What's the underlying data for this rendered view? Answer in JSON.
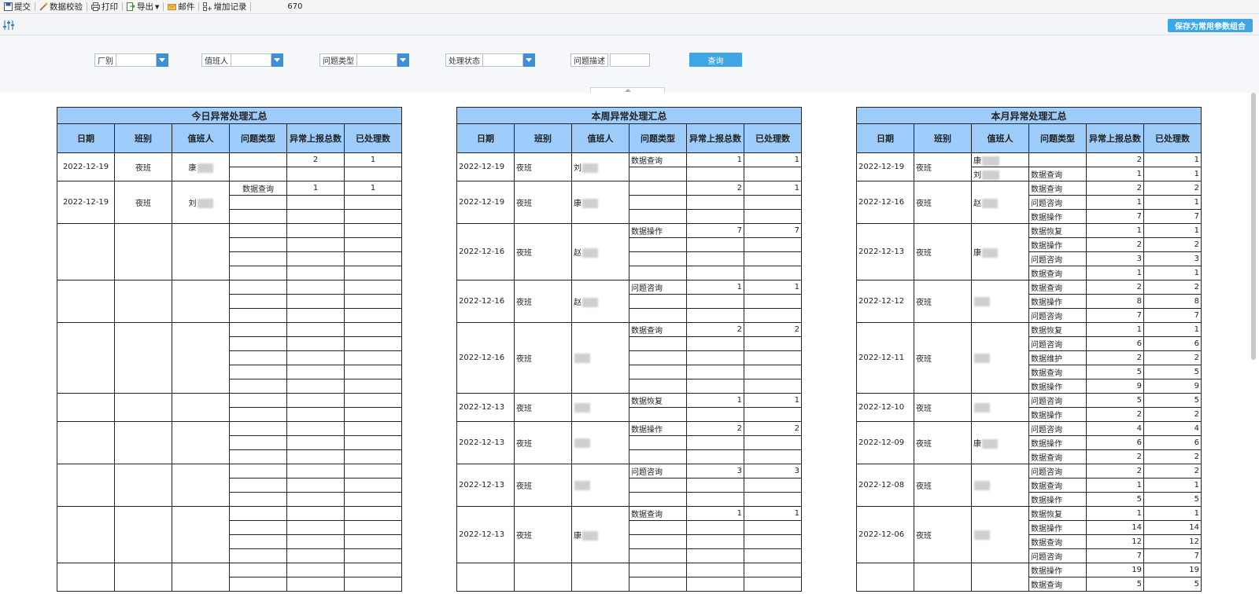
{
  "toolbar": {
    "submit_label": "提交",
    "validate_label": "数据校验",
    "print_label": "打印",
    "export_label": "导出",
    "mail_label": "邮件",
    "add_record_label": "增加记录",
    "record_count": "670"
  },
  "params": {
    "save_combo_label": "保存为常用参数组合",
    "factory_label": "厂别",
    "duty_person_label": "值班人",
    "issue_type_label": "问题类型",
    "status_label": "处理状态",
    "issue_desc_label": "问题描述",
    "query_label": "查询"
  },
  "colors": {
    "header_blue": "#9fcdfb",
    "accent": "#3ea6e5",
    "dropdown_blue": "#3d8fd6"
  },
  "headers": [
    "日期",
    "班别",
    "值班人",
    "问题类型",
    "异常上报总数",
    "已处理数"
  ],
  "today": {
    "title": "今日异常处理汇总",
    "groups": [
      {
        "date": "2022-12-19",
        "shift": "夜班",
        "person": "康",
        "rows": [
          [
            "",
            "2",
            "1"
          ],
          [
            "",
            "",
            ""
          ]
        ]
      },
      {
        "date": "2022-12-19",
        "shift": "夜班",
        "person": "刘",
        "rows": [
          [
            "数据查询",
            "1",
            "1"
          ],
          [
            "",
            "",
            ""
          ],
          [
            "",
            "",
            ""
          ]
        ]
      },
      {
        "date": "",
        "shift": "",
        "person": "",
        "rows": [
          [
            "",
            "",
            ""
          ],
          [
            "",
            "",
            ""
          ],
          [
            "",
            "",
            ""
          ],
          [
            "",
            "",
            ""
          ]
        ]
      },
      {
        "date": "",
        "shift": "",
        "person": "",
        "rows": [
          [
            "",
            "",
            ""
          ],
          [
            "",
            "",
            ""
          ],
          [
            "",
            "",
            ""
          ]
        ]
      },
      {
        "date": "",
        "shift": "",
        "person": "",
        "rows": [
          [
            "",
            "",
            ""
          ],
          [
            "",
            "",
            ""
          ],
          [
            "",
            "",
            ""
          ],
          [
            "",
            "",
            ""
          ],
          [
            "",
            "",
            ""
          ]
        ]
      },
      {
        "date": "",
        "shift": "",
        "person": "",
        "rows": [
          [
            "",
            "",
            ""
          ],
          [
            "",
            "",
            ""
          ]
        ]
      },
      {
        "date": "",
        "shift": "",
        "person": "",
        "rows": [
          [
            "",
            "",
            ""
          ],
          [
            "",
            "",
            ""
          ],
          [
            "",
            "",
            ""
          ]
        ]
      },
      {
        "date": "",
        "shift": "",
        "person": "",
        "rows": [
          [
            "",
            "",
            ""
          ],
          [
            "",
            "",
            ""
          ],
          [
            "",
            "",
            ""
          ]
        ]
      },
      {
        "date": "",
        "shift": "",
        "person": "",
        "rows": [
          [
            "",
            "",
            ""
          ],
          [
            "",
            "",
            ""
          ],
          [
            "",
            "",
            ""
          ],
          [
            "",
            "",
            ""
          ]
        ]
      },
      {
        "date": "",
        "shift": "",
        "person": "",
        "rows": [
          [
            "",
            "",
            ""
          ],
          [
            "",
            "",
            ""
          ]
        ]
      }
    ]
  },
  "week": {
    "title": "本周异常处理汇总",
    "groups": [
      {
        "date": "2022-12-19",
        "shift": "夜班",
        "person": "刘",
        "rows": [
          [
            "数据查询",
            "1",
            "1"
          ],
          [
            "",
            "",
            ""
          ]
        ]
      },
      {
        "date": "2022-12-19",
        "shift": "夜班",
        "person": "康",
        "rows": [
          [
            "",
            "2",
            "1"
          ],
          [
            "",
            "",
            ""
          ],
          [
            "",
            "",
            ""
          ]
        ]
      },
      {
        "date": "2022-12-16",
        "shift": "夜班",
        "person": "赵",
        "rows": [
          [
            "数据操作",
            "7",
            "7"
          ],
          [
            "",
            "",
            ""
          ],
          [
            "",
            "",
            ""
          ],
          [
            "",
            "",
            ""
          ]
        ]
      },
      {
        "date": "2022-12-16",
        "shift": "夜班",
        "person": "赵",
        "rows": [
          [
            "问题咨询",
            "1",
            "1"
          ],
          [
            "",
            "",
            ""
          ],
          [
            "",
            "",
            ""
          ]
        ]
      },
      {
        "date": "2022-12-16",
        "shift": "夜班",
        "person": "",
        "rows": [
          [
            "数据查询",
            "2",
            "2"
          ],
          [
            "",
            "",
            ""
          ],
          [
            "",
            "",
            ""
          ],
          [
            "",
            "",
            ""
          ],
          [
            "",
            "",
            ""
          ]
        ]
      },
      {
        "date": "2022-12-13",
        "shift": "夜班",
        "person": "",
        "rows": [
          [
            "数据恢复",
            "1",
            "1"
          ],
          [
            "",
            "",
            ""
          ]
        ]
      },
      {
        "date": "2022-12-13",
        "shift": "夜班",
        "person": "",
        "rows": [
          [
            "数据操作",
            "2",
            "2"
          ],
          [
            "",
            "",
            ""
          ],
          [
            "",
            "",
            ""
          ]
        ]
      },
      {
        "date": "2022-12-13",
        "shift": "夜班",
        "person": "",
        "rows": [
          [
            "问题咨询",
            "3",
            "3"
          ],
          [
            "",
            "",
            ""
          ],
          [
            "",
            "",
            ""
          ]
        ]
      },
      {
        "date": "2022-12-13",
        "shift": "夜班",
        "person": "康",
        "rows": [
          [
            "数据查询",
            "1",
            "1"
          ],
          [
            "",
            "",
            ""
          ],
          [
            "",
            "",
            ""
          ],
          [
            "",
            "",
            ""
          ]
        ]
      },
      {
        "date": "",
        "shift": "",
        "person": "",
        "rows": [
          [
            "",
            "",
            ""
          ],
          [
            "",
            "",
            ""
          ]
        ]
      }
    ]
  },
  "month": {
    "title": "本月异常处理汇总",
    "groups": [
      {
        "date": "2022-12-19",
        "shift": "夜班",
        "persons": [
          "康",
          "刘"
        ],
        "rows": [
          [
            "",
            "2",
            "1"
          ],
          [
            "数据查询",
            "1",
            "1"
          ]
        ]
      },
      {
        "date": "2022-12-16",
        "shift": "夜班",
        "person": "赵",
        "rows": [
          [
            "数据查询",
            "2",
            "2"
          ],
          [
            "问题咨询",
            "1",
            "1"
          ],
          [
            "数据操作",
            "7",
            "7"
          ]
        ]
      },
      {
        "date": "2022-12-13",
        "shift": "夜班",
        "person": "康",
        "rows": [
          [
            "数据恢复",
            "1",
            "1"
          ],
          [
            "数据操作",
            "2",
            "2"
          ],
          [
            "问题咨询",
            "3",
            "3"
          ],
          [
            "数据查询",
            "1",
            "1"
          ]
        ]
      },
      {
        "date": "2022-12-12",
        "shift": "夜班",
        "person": "",
        "rows": [
          [
            "数据查询",
            "2",
            "2"
          ],
          [
            "数据操作",
            "8",
            "8"
          ],
          [
            "问题咨询",
            "7",
            "7"
          ]
        ]
      },
      {
        "date": "2022-12-11",
        "shift": "夜班",
        "person": "",
        "rows": [
          [
            "数据恢复",
            "1",
            "1"
          ],
          [
            "问题咨询",
            "6",
            "6"
          ],
          [
            "数据维护",
            "2",
            "2"
          ],
          [
            "数据查询",
            "5",
            "5"
          ],
          [
            "数据操作",
            "9",
            "9"
          ]
        ]
      },
      {
        "date": "2022-12-10",
        "shift": "夜班",
        "person": "",
        "rows": [
          [
            "问题咨询",
            "5",
            "5"
          ],
          [
            "数据操作",
            "2",
            "2"
          ]
        ]
      },
      {
        "date": "2022-12-09",
        "shift": "夜班",
        "person": "康",
        "rows": [
          [
            "问题咨询",
            "4",
            "4"
          ],
          [
            "数据操作",
            "6",
            "6"
          ],
          [
            "数据查询",
            "2",
            "2"
          ]
        ]
      },
      {
        "date": "2022-12-08",
        "shift": "夜班",
        "person": "",
        "rows": [
          [
            "问题咨询",
            "2",
            "2"
          ],
          [
            "数据查询",
            "1",
            "1"
          ],
          [
            "数据操作",
            "5",
            "5"
          ]
        ]
      },
      {
        "date": "2022-12-06",
        "shift": "夜班",
        "person": "",
        "rows": [
          [
            "数据恢复",
            "1",
            "1"
          ],
          [
            "数据操作",
            "14",
            "14"
          ],
          [
            "数据查询",
            "12",
            "12"
          ],
          [
            "问题咨询",
            "7",
            "7"
          ]
        ]
      },
      {
        "date": "",
        "shift": "",
        "person": "",
        "rows": [
          [
            "数据操作",
            "19",
            "19"
          ],
          [
            "数据查询",
            "5",
            "5"
          ]
        ]
      }
    ]
  }
}
